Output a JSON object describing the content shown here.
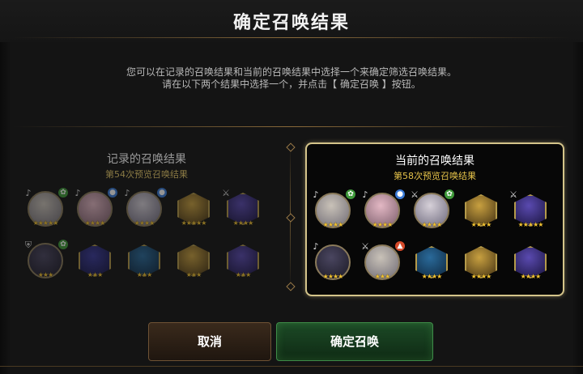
{
  "title": "确定召唤结果",
  "description": {
    "line1": "您可以在记录的召唤结果和当前的召唤结果中选择一个来确定筛选召唤结果。",
    "line2": "请在以下两个结果中选择一个，并点击【 确定召唤 】按钮。"
  },
  "recorded": {
    "title": "记录的召唤结果",
    "subtitle": "第54次预览召唤结果",
    "slots": [
      {
        "type": "hero",
        "element": "♪",
        "badge": "leaf",
        "stars": "★★★★★"
      },
      {
        "type": "hero",
        "element": "♪",
        "badge": "water",
        "stars": "★★★★"
      },
      {
        "type": "hero",
        "element": "♪",
        "badge": "water",
        "stars": "★★★★"
      },
      {
        "type": "artifact",
        "element": "",
        "badge": "",
        "stars": "★★★★★"
      },
      {
        "type": "artifact",
        "element": "⚔",
        "badge": "",
        "stars": "★★★★"
      },
      {
        "type": "hero",
        "element": "⛨",
        "badge": "leaf",
        "stars": "★★★"
      },
      {
        "type": "artifact",
        "element": "",
        "badge": "",
        "stars": "★★★"
      },
      {
        "type": "artifact",
        "element": "",
        "badge": "",
        "stars": "★★★"
      },
      {
        "type": "artifact",
        "element": "",
        "badge": "",
        "stars": "★★★"
      },
      {
        "type": "artifact",
        "element": "",
        "badge": "",
        "stars": "★★★"
      }
    ]
  },
  "current": {
    "title": "当前的召唤结果",
    "subtitle": "第58次预览召唤结果",
    "slots": [
      {
        "type": "hero",
        "element": "♪",
        "badge": "leaf",
        "stars": "★★★★"
      },
      {
        "type": "hero",
        "element": "♪",
        "badge": "water",
        "stars": "★★★★"
      },
      {
        "type": "hero",
        "element": "⚔",
        "badge": "leaf",
        "stars": "★★★★"
      },
      {
        "type": "artifact",
        "element": "",
        "badge": "",
        "stars": "★★★★"
      },
      {
        "type": "artifact",
        "element": "⚔",
        "badge": "",
        "stars": "★★★★★"
      },
      {
        "type": "hero",
        "element": "♪",
        "badge": "",
        "stars": "★★★★"
      },
      {
        "type": "hero",
        "element": "⚔",
        "badge": "fire",
        "stars": "★★★"
      },
      {
        "type": "artifact",
        "element": "",
        "badge": "",
        "stars": "★★★★"
      },
      {
        "type": "artifact",
        "element": "",
        "badge": "",
        "stars": "★★★★"
      },
      {
        "type": "artifact",
        "element": "",
        "badge": "",
        "stars": "★★★★"
      }
    ]
  },
  "buttons": {
    "cancel": "取消",
    "confirm": "确定召唤"
  },
  "colors": {
    "accent_gold": "#d4c48a",
    "subtitle_gold": "#e6c34a",
    "confirm_green": "#1c4a26",
    "cancel_brown": "#3a2a1c",
    "star": "#f1c232"
  }
}
